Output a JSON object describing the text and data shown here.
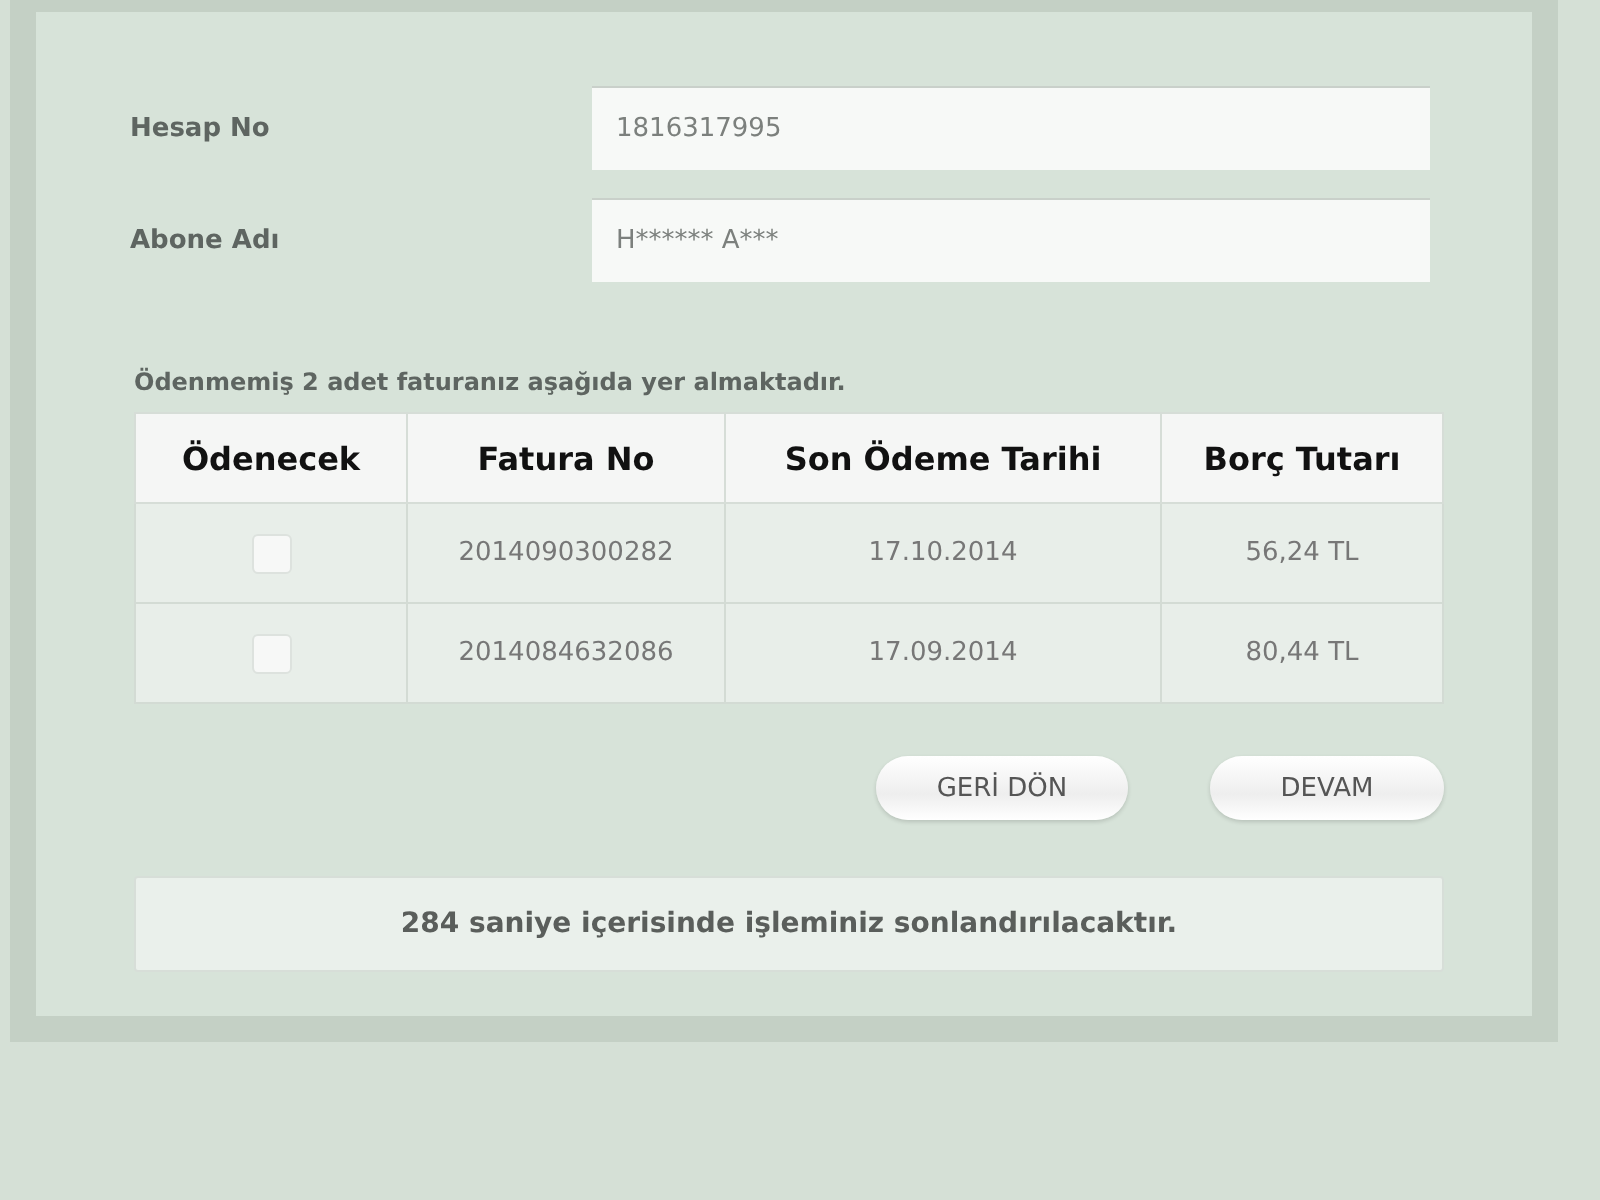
{
  "fields": [
    {
      "label": "Hesap No",
      "value": "1816317995"
    },
    {
      "label": "Abone Adı",
      "value": "H****** A***"
    }
  ],
  "message": "Ödenmemiş 2 adet faturanız aşağıda yer almaktadır.",
  "table": {
    "columns": [
      "Ödenecek",
      "Fatura No",
      "Son Ödeme Tarihi",
      "Borç Tutarı"
    ],
    "rows": [
      {
        "checked": false,
        "invoice": "2014090300282",
        "due": "17.10.2014",
        "amount": "56,24 TL"
      },
      {
        "checked": false,
        "invoice": "2014084632086",
        "due": "17.09.2014",
        "amount": "80,44 TL"
      }
    ]
  },
  "buttons": [
    "GERİ DÖN",
    "DEVAM"
  ],
  "timer": "284 saniye içerisinde işleminiz sonlandırılacaktır."
}
